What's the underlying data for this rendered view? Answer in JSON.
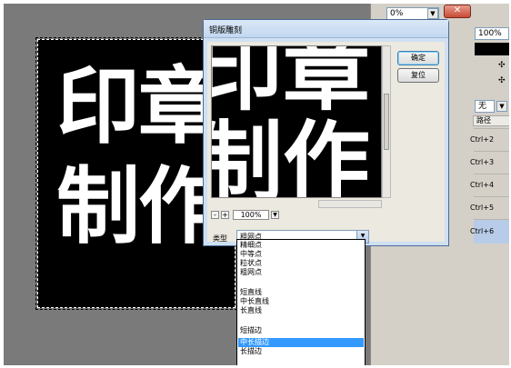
{
  "canvas": {
    "text": "印章\n制作"
  },
  "panel": {
    "opacity_value": "0%",
    "fill_value": "100%",
    "tool_label": "无",
    "tab_label": "路径",
    "shortcuts": [
      "Ctrl+2",
      "Ctrl+3",
      "Ctrl+4",
      "Ctrl+5",
      "Ctrl+6"
    ]
  },
  "dialog": {
    "title": "铜版雕刻",
    "ok_label": "确定",
    "reset_label": "复位",
    "zoom_value": "100%",
    "zoom_out": "-",
    "zoom_in": "+",
    "type_label": "类型",
    "type_value": "粗网点",
    "close_label": "✕"
  },
  "dropdown": {
    "options": [
      {
        "label": "精细点",
        "selected": false
      },
      {
        "label": "中等点",
        "selected": false
      },
      {
        "label": "粒状点",
        "selected": false
      },
      {
        "label": "粗网点",
        "selected": false
      },
      {
        "label": "短直线",
        "selected": false
      },
      {
        "label": "中长直线",
        "selected": false
      },
      {
        "label": "长直线",
        "selected": false
      },
      {
        "label": "短描边",
        "selected": false
      },
      {
        "label": "中长描边",
        "selected": true
      },
      {
        "label": "长描边",
        "selected": false
      }
    ]
  }
}
